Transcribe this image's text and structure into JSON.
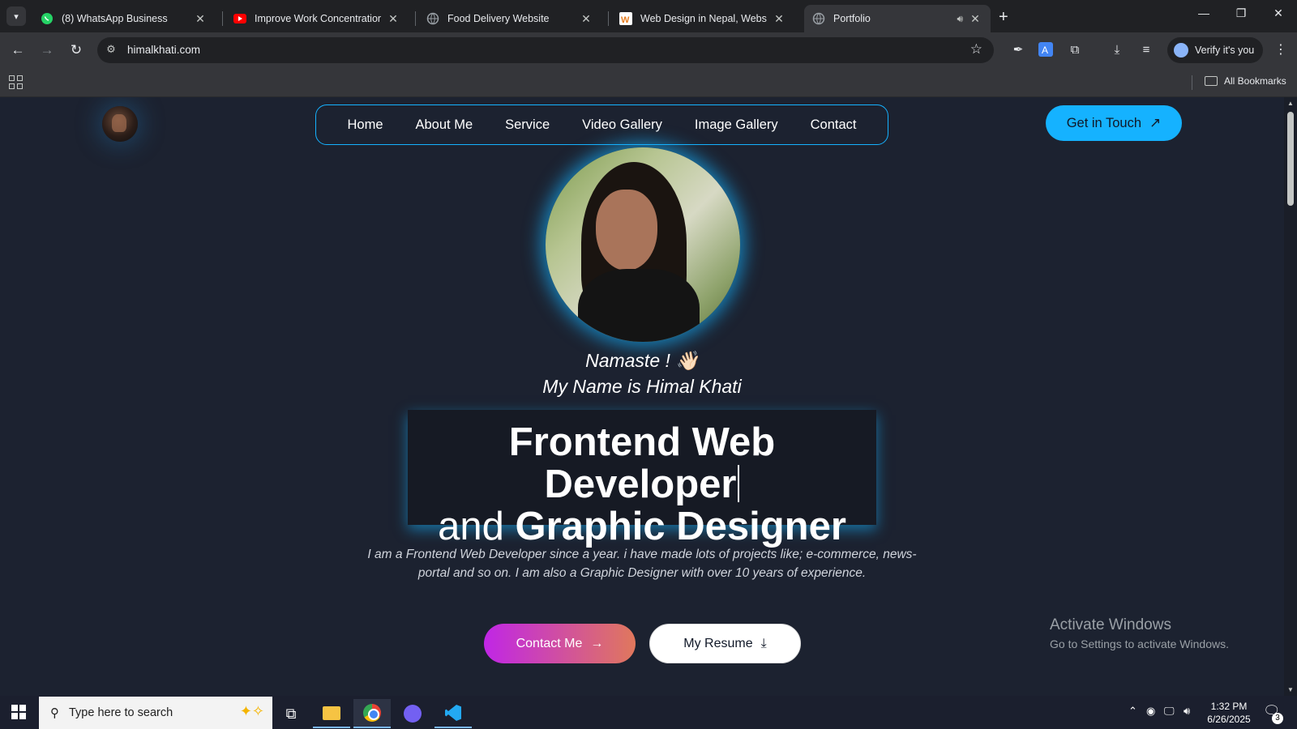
{
  "browser": {
    "tabs": [
      {
        "title": "(8) WhatsApp Business",
        "icon": "whatsapp-icon"
      },
      {
        "title": "Improve Work Concentration –",
        "icon": "youtube-icon"
      },
      {
        "title": "Food Delivery Website",
        "icon": "globe-icon"
      },
      {
        "title": "Web Design in Nepal, Website",
        "icon": "webdesign-icon"
      },
      {
        "title": "Portfolio",
        "icon": "globe-icon",
        "active": true
      }
    ],
    "url": "himalkhati.com",
    "verify_label": "Verify it's you",
    "all_bookmarks": "All Bookmarks"
  },
  "site": {
    "nav": [
      "Home",
      "About Me",
      "Service",
      "Video Gallery",
      "Image Gallery",
      "Contact"
    ],
    "cta": "Get in Touch",
    "greeting": "Namaste ! 👋🏻",
    "intro": "My Name is Himal Khati",
    "headline_line1": "Frontend Web Developer",
    "headline_line2_plain": "and",
    "headline_line2_bold": "Graphic Designer",
    "bio": "I am a Frontend Web Developer since a year. i have made lots of projects like; e-commerce, news-portal and so on. I am also a Graphic Designer with over 10 years of experience.",
    "contact_btn": "Contact Me",
    "resume_btn": "My Resume"
  },
  "watermark": {
    "title": "Activate Windows",
    "subtitle": "Go to Settings to activate Windows."
  },
  "taskbar": {
    "search_placeholder": "Type here to search",
    "time": "1:32 PM",
    "date": "6/26/2025",
    "notification_count": "3"
  },
  "colors": {
    "accent": "#15b2ff",
    "page_bg": "#1c2230",
    "contact_gradient_start": "#c026e6",
    "contact_gradient_end": "#e0785c"
  }
}
